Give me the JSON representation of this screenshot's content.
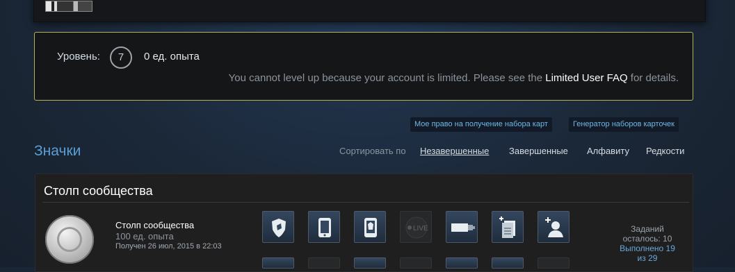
{
  "level": {
    "label": "Уровень:",
    "value": "7",
    "xp": "0 ед. опыта",
    "limited_message": "You cannot level up because your account is limited. Please see the",
    "faq_link": "Limited User FAQ",
    "limited_suffix": "for details."
  },
  "card_buttons": {
    "eligibility": "Мое право на получение набора карт",
    "booster_creator": "Генератор наборов карточек"
  },
  "badges": {
    "title": "Значки",
    "sort_label": "Сортировать по",
    "sort_options": [
      "Незавершенные",
      "Завершенные",
      "Алфавиту",
      "Редкости"
    ],
    "active_sort": "Незавершенные"
  },
  "badge_panel": {
    "title": "Столп сообщества",
    "badge_name": "Столп сообщества",
    "badge_xp": "100 ед. опыта",
    "badge_date": "Получен 26 июл, 2015 в 22:03",
    "tasks_remaining_label": "Заданий",
    "tasks_remaining": "осталось: 10",
    "completed": "Выполнено 19",
    "of_total": "из 29",
    "task_icons": [
      "shield-icon",
      "phone-icon",
      "mobile-confirm-icon",
      "live-broadcast-icon",
      "plug-icon",
      "documents-add-icon",
      "add-friend-icon"
    ],
    "live_text": "LIVE"
  },
  "colors": {
    "accent_blue": "#5a9fd6",
    "level_box_border": "#b4b459",
    "link_blue": "#70b8e6"
  }
}
